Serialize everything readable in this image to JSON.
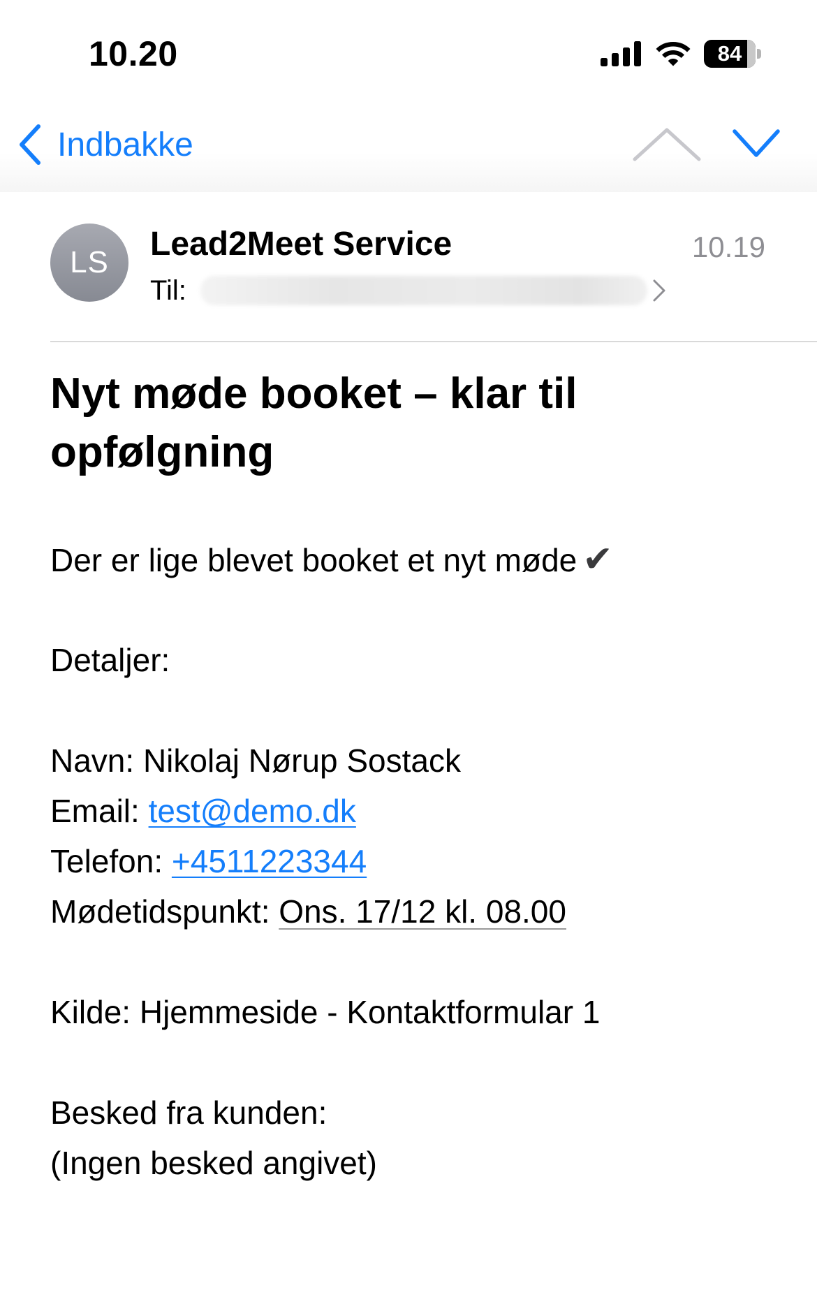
{
  "status_bar": {
    "time": "10.20",
    "battery_level": "84",
    "battery_fraction": 0.84
  },
  "nav": {
    "back_label": "Indbakke",
    "accent_color": "#147efb"
  },
  "header": {
    "avatar_initials": "LS",
    "sender": "Lead2Meet Service",
    "time": "10.19",
    "to_label": "Til:"
  },
  "subject": "Nyt møde booket – klar til opfølgning",
  "body": {
    "intro": "Der er lige blevet booket et nyt møde",
    "intro_mark": "✔",
    "details_heading": "Detaljer:",
    "name_label": "Navn:",
    "name_value": "Nikolaj Nørup Sostack",
    "email_label": "Email:",
    "email_value": "test@demo.dk",
    "phone_label": "Telefon:",
    "phone_value": "+4511223344",
    "meeting_label": "Mødetidspunkt:",
    "meeting_value": "Ons. 17/12 kl. 08.00",
    "source_label": "Kilde:",
    "source_value": "Hjemmeside - Kontaktformular 1",
    "message_heading": "Besked fra kunden:",
    "message_value": "(Ingen besked angivet)"
  }
}
